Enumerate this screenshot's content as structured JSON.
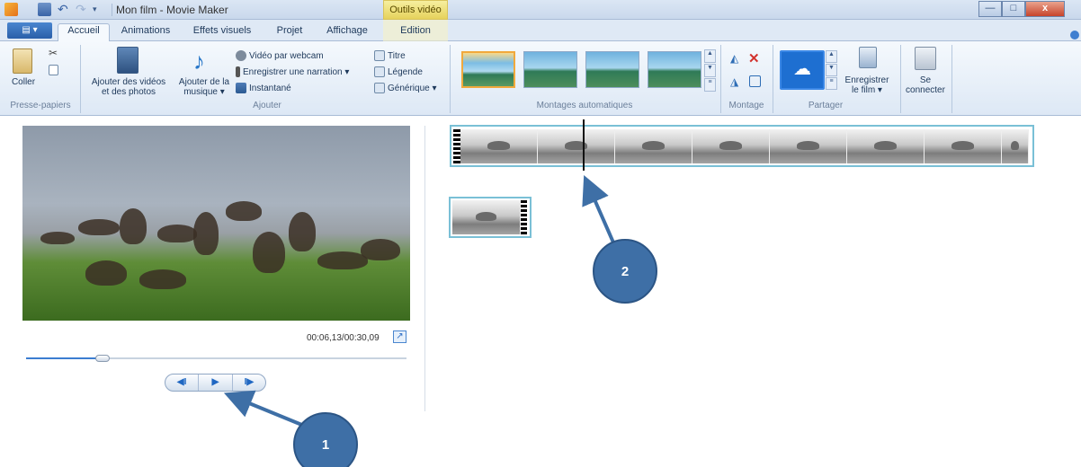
{
  "window": {
    "title": "Mon film - Movie Maker",
    "contextual_tab_header": "Outils vidéo",
    "controls": {
      "minimize": "—",
      "maximize": "□",
      "close": "x"
    }
  },
  "qat": {
    "undo": "↶",
    "redo": "↷",
    "dropdown": "▾"
  },
  "tabs": [
    {
      "label": "Accueil",
      "active": true
    },
    {
      "label": "Animations",
      "active": false
    },
    {
      "label": "Effets visuels",
      "active": false
    },
    {
      "label": "Projet",
      "active": false
    },
    {
      "label": "Affichage",
      "active": false
    },
    {
      "label": "Edition",
      "active": false
    }
  ],
  "file_menu": "▤ ▾",
  "ribbon": {
    "clipboard": {
      "group_label": "Presse-papiers",
      "paste": "Coller"
    },
    "add": {
      "group_label": "Ajouter",
      "add_videos_line1": "Ajouter des vidéos",
      "add_videos_line2": "et des photos",
      "add_music_line1": "Ajouter de la",
      "add_music_line2": "musique ▾",
      "webcam": "Vidéo par webcam",
      "narration": "Enregistrer une narration ▾",
      "snapshot": "Instantané",
      "title": "Titre",
      "caption": "Légende",
      "credits": "Générique ▾"
    },
    "automovie": {
      "group_label": "Montages automatiques"
    },
    "editing": {
      "group_label": "Montage"
    },
    "share": {
      "group_label": "Partager",
      "save_movie_line1": "Enregistrer",
      "save_movie_line2": "le film ▾",
      "sign_in_line1": "Se",
      "sign_in_line2": "connecter"
    }
  },
  "preview": {
    "timecode": "00:06,13/00:30,09",
    "progress": 0.2,
    "controls": {
      "previous": "◀I",
      "play": "▶",
      "next": "I▶"
    }
  },
  "callouts": {
    "one": "1",
    "two": "2"
  },
  "colors": {
    "accent": "#3b7dd1",
    "callout": "#3e6fa6",
    "clip_border": "#7ac0d6"
  }
}
